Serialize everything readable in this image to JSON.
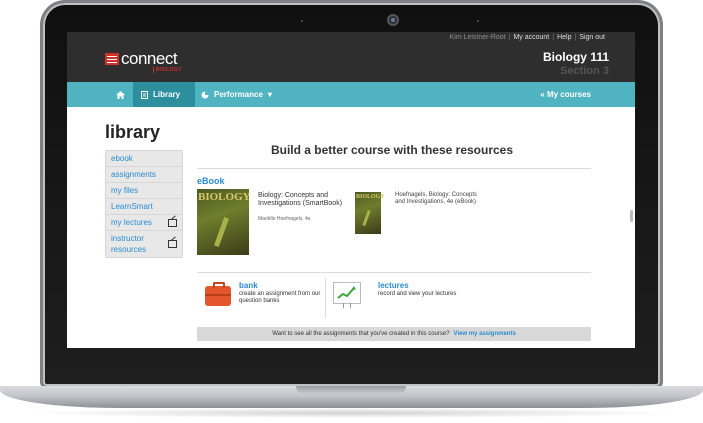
{
  "header": {
    "user": "Kim Leistner-Root",
    "links": [
      "My account",
      "Help",
      "Sign out"
    ],
    "logo_text": "connect",
    "logo_sub": "BIOLOGY",
    "course_title": "Biology 111",
    "course_section": "Section 3"
  },
  "nav": {
    "home_icon": "home-icon",
    "library": "Library",
    "performance": "Performance",
    "my_courses": "« My courses"
  },
  "page": {
    "title": "library"
  },
  "sidebar": {
    "items": [
      {
        "label": "ebook",
        "external": false
      },
      {
        "label": "assignments",
        "external": false
      },
      {
        "label": "my files",
        "external": false
      },
      {
        "label": "LearnSmart",
        "external": false
      },
      {
        "label": "my lectures",
        "external": true
      },
      {
        "label": "instructor resources",
        "external": true
      }
    ]
  },
  "main": {
    "headline": "Build a better course with these resources",
    "ebook_label": "eBook",
    "book1": {
      "cover_text": "BIOLOGY",
      "title": "Biology: Concepts and Investigations (SmartBook)",
      "author": "Mariëlle Hoefnagels, 4e"
    },
    "book2": {
      "cover_text": "BIOLOGY",
      "title": "Hoefnagels, Biology: Concepts and Investigations, 4e (eBook)"
    },
    "bank": {
      "title": "bank",
      "desc": "create an assignment from our question banks"
    },
    "lectures": {
      "title": "lectures",
      "desc": "record and view your lectures"
    },
    "footer": {
      "text": "Want to see all the assignments that you've created in this course?",
      "link": "View my assignments"
    }
  },
  "colors": {
    "navbar": "#4fb3c2",
    "navbar_active": "#2d8e9e",
    "brand_red": "#d0312d",
    "link_blue": "#2a8bd1"
  }
}
